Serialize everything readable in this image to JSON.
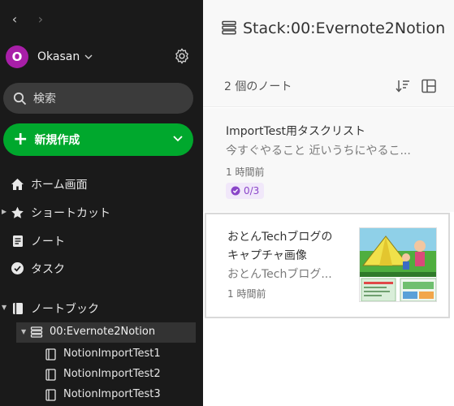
{
  "sidebar": {
    "account": {
      "initial": "O",
      "name": "Okasan"
    },
    "search": {
      "label": "検索"
    },
    "new_button": {
      "label": "新規作成"
    },
    "nav": {
      "home": "ホーム画面",
      "shortcuts": "ショートカット",
      "notes": "ノート",
      "tasks": "タスク",
      "notebooks": "ノートブック"
    },
    "stack": {
      "label": "00:Evernote2Notion"
    },
    "notebooks": [
      {
        "label": "NotionImportTest1"
      },
      {
        "label": "NotionImportTest2"
      },
      {
        "label": "NotionImportTest3"
      }
    ]
  },
  "main": {
    "title": "Stack:00:Evernote2Notion",
    "note_count": "2 個のノート",
    "notes": [
      {
        "title": "ImportTest用タスクリスト",
        "snippet": "今すぐやること 近いうちにやるこ...",
        "time": "1 時間前",
        "task_progress": "0/3"
      },
      {
        "title_line1": "おとんTechブログの",
        "title_line2": "キャプチャ画像",
        "snippet": "おとんTechブログ...",
        "time": "1 時間前"
      }
    ]
  },
  "colors": {
    "sidebar_bg": "#1a1a1a",
    "accent_green": "#00a82d",
    "avatar_purple": "#a81fa8",
    "task_purple": "#8a45c9"
  },
  "icons": [
    "back-arrow-icon",
    "forward-arrow-icon",
    "chevron-down-icon",
    "gear-icon",
    "search-icon",
    "plus-icon",
    "home-icon",
    "star-icon",
    "note-icon",
    "task-check-icon",
    "notebook-icon",
    "stack-icon",
    "sort-icon",
    "view-icon"
  ]
}
